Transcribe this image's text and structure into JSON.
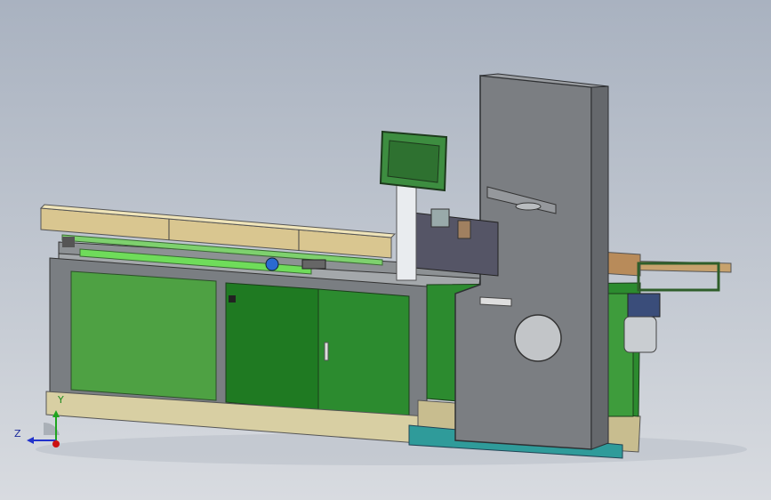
{
  "triad": {
    "x_label": "",
    "y_label": "Y",
    "z_label": "Z"
  },
  "colors": {
    "background_top": "#a9b2c0",
    "background_bottom": "#d8dbe0",
    "frame": "#8b8f93",
    "panel_green": "#4ea143",
    "panel_dark_green": "#1f7a22",
    "beam_tan": "#d9c690",
    "base_plate": "#d8cfa3",
    "teal_base": "#2f9b9a",
    "saw_gray": "#7b7e82",
    "control_box": "#3d8d40"
  }
}
